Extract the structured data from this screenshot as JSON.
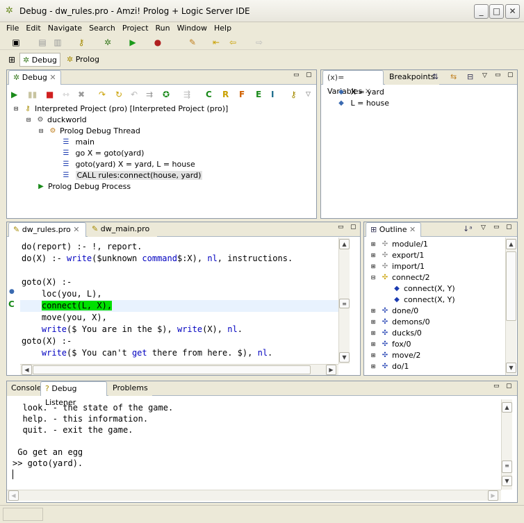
{
  "window": {
    "title": "Debug - dw_rules.pro - Amzi! Prolog + Logic Server IDE"
  },
  "menu": [
    "File",
    "Edit",
    "Navigate",
    "Search",
    "Project",
    "Run",
    "Window",
    "Help"
  ],
  "perspectives": {
    "debug": "Debug",
    "prolog": "Prolog"
  },
  "debug_view": {
    "tab": "Debug",
    "tree": [
      "Interpreted Project (pro) [Interpreted Project (pro)]",
      "duckworld",
      "Prolog Debug Thread",
      "main",
      "go   X = goto(yard)",
      "goto(yard)   X = yard, L = house",
      "CALL rules:connect(house, yard)",
      "Prolog Debug Process"
    ]
  },
  "variables_view": {
    "tabs": [
      "Variables",
      "Breakpoints"
    ],
    "vars": [
      "X = yard",
      "L = house"
    ]
  },
  "editor": {
    "tabs": [
      "dw_rules.pro",
      "dw_main.pro"
    ],
    "lines": [
      "do(report) :- !, report.",
      "do(X) :- write($unknown command$:X), nl, instructions.",
      "",
      "goto(X) :-",
      "    loc(you, L),",
      "    connect(L, X),",
      "    move(you, X),",
      "    write($ You are in the $), write(X), nl.",
      "goto(X) :-",
      "    write($ You can't get there from here. $), nl."
    ]
  },
  "outline": {
    "tab": "Outline",
    "items": [
      "module/1",
      "export/1",
      "import/1",
      "connect/2",
      "connect(X, Y)",
      "connect(X, Y)",
      "done/0",
      "demons/0",
      "ducks/0",
      "fox/0",
      "move/2",
      "do/1"
    ]
  },
  "console": {
    "tabs": [
      "Console",
      "Debug Listener",
      "Problems"
    ],
    "lines": [
      "  look. - the state of the game.",
      "  help. - this information.",
      "  quit. - exit the game.",
      "",
      " Go get an egg",
      ">> goto(yard)."
    ]
  },
  "colors": {
    "highlight": "#00e000",
    "keyword": "#0000c0"
  }
}
